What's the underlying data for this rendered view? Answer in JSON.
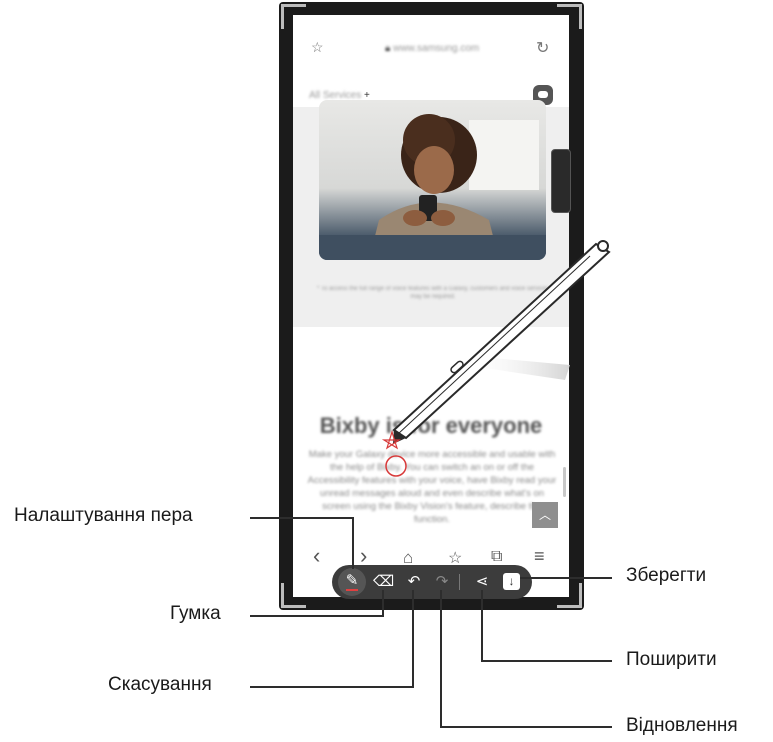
{
  "browser": {
    "url": "www.samsung.com",
    "services_label": "All Services",
    "plus": "+"
  },
  "article": {
    "caption": "* To access the full range of voice features with a Galaxy, customers and voice services may be required.",
    "heading": "Bixby is for everyone",
    "body": "Make your Galaxy device more accessible and usable with the help of Bixby. You can switch an on or off the Accessibility features with your voice, have Bixby read your unread messages aloud and even describe what's on screen using the Bixby Vision's feature, describe the function."
  },
  "nav": {
    "back": "‹",
    "forward": "›",
    "home": "⌂",
    "bookmark": "☆",
    "tabs": "⧉",
    "menu": "≡",
    "scroll_top": "︿"
  },
  "toolbar": {
    "pen_icon": "pencil-icon",
    "eraser_icon": "eraser-icon",
    "undo_icon": "undo-icon",
    "redo_icon": "redo-icon",
    "share_icon": "share-icon",
    "save_icon": "save-icon"
  },
  "callouts": {
    "pen_settings": "Налаштування пера",
    "eraser": "Гумка",
    "undo": "Скасування",
    "save": "Зберегти",
    "share": "Поширити",
    "redo": "Відновлення"
  }
}
